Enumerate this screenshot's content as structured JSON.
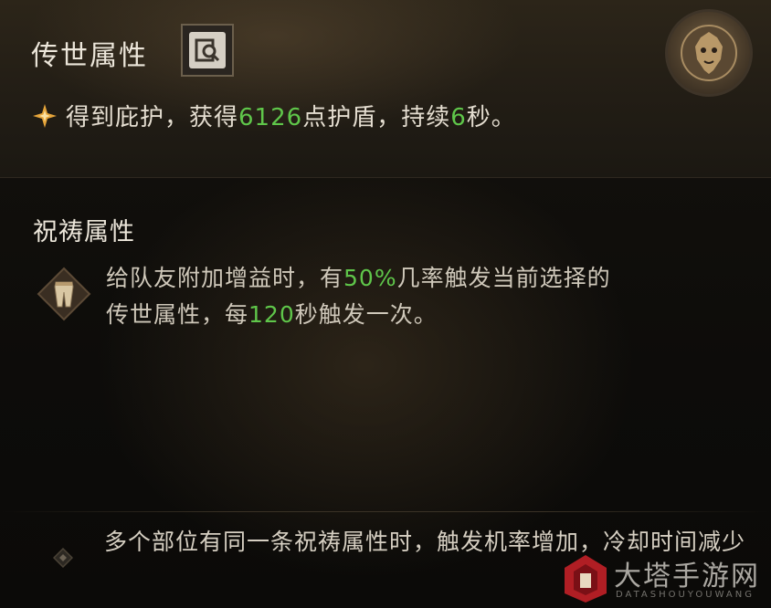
{
  "legendary": {
    "title": "传世属性",
    "codex_icon": "codex-search-icon",
    "emblem_icon": "lion-emblem-icon",
    "effect": {
      "prefix": "得到庇护，获得",
      "shield_value": "6126",
      "middle": "点护盾，持续",
      "duration": "6",
      "suffix": "秒。"
    }
  },
  "blessing": {
    "title": "祝祷属性",
    "item_icon": "pants-icon",
    "line1_prefix": "给队友附加增益时，有",
    "chance": "50%",
    "line1_suffix": "几率触发当前选择的",
    "line2_prefix": "传世属性，每",
    "cooldown": "120",
    "line2_suffix": "秒触发一次。"
  },
  "note": {
    "text": "多个部位有同一条祝祷属性时，触发机率增加，冷却时间减少"
  },
  "watermark": {
    "title": "大塔手游网",
    "subtitle": "DATASHOUYOUWANG"
  },
  "colors": {
    "highlight": "#5fc64a",
    "gold": "#e6a53a",
    "text": "#e4ddd0"
  }
}
